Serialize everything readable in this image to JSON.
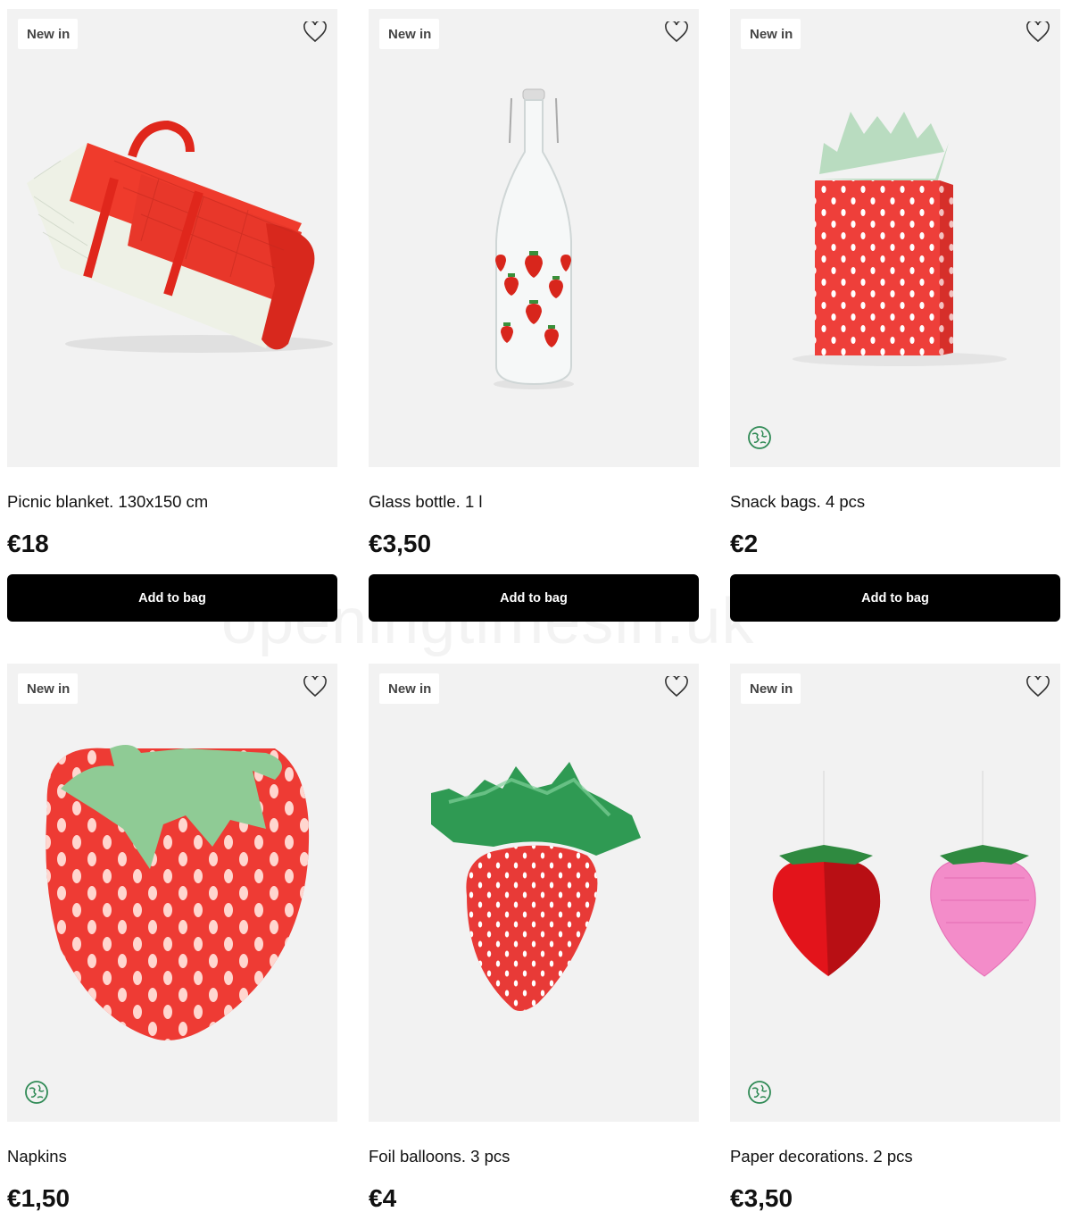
{
  "watermark": "openingtimesin.uk",
  "products": [
    {
      "badge": "New in",
      "title": "Picnic blanket. 130x150 cm",
      "price": "€18",
      "add_label": "Add to bag",
      "eco": false
    },
    {
      "badge": "New in",
      "title": "Glass bottle. 1 l",
      "price": "€3,50",
      "add_label": "Add to bag",
      "eco": false
    },
    {
      "badge": "New in",
      "title": "Snack bags. 4 pcs",
      "price": "€2",
      "add_label": "Add to bag",
      "eco": true
    },
    {
      "badge": "New in",
      "title": "Napkins",
      "price": "€1,50",
      "eco": true
    },
    {
      "badge": "New in",
      "title": "Foil balloons. 3 pcs",
      "price": "€4",
      "eco": false
    },
    {
      "badge": "New in",
      "title": "Paper decorations. 2 pcs",
      "price": "€3,50",
      "eco": true
    }
  ],
  "icons": {
    "wishlist": "heart-icon",
    "eco": "globe-leaf-icon"
  },
  "colors": {
    "button": "#000000",
    "card_bg": "#f2f2f2",
    "eco_green": "#2f8a55"
  }
}
